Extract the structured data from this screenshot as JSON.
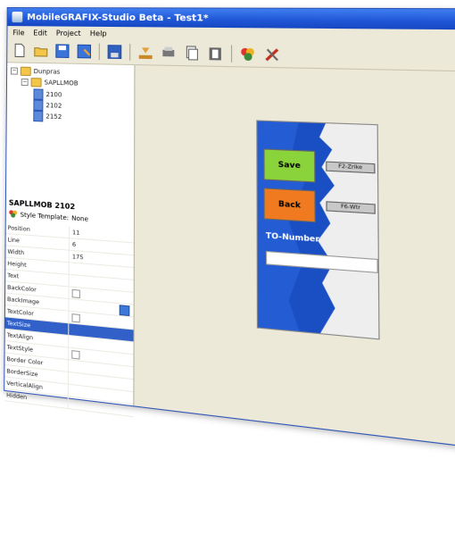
{
  "window": {
    "title": "MobileGRAFIX-Studio Beta - Test1*",
    "buttons": [
      "_",
      "□",
      "✕"
    ]
  },
  "menu": [
    "File",
    "Edit",
    "Project",
    "Help"
  ],
  "toolbar": {
    "icons": [
      "new-icon",
      "open-icon",
      "save-icon",
      "save-as-icon",
      "save-disk-icon",
      "import-icon",
      "export-icon",
      "copy-icon",
      "paste-icon",
      "palette-icon",
      "tools-icon"
    ]
  },
  "tree": {
    "root": "Dunpras",
    "project": "SAPLLMOB",
    "screens": [
      "2100",
      "2102",
      "2152"
    ]
  },
  "selection": {
    "title": "SAPLLMOB 2102",
    "style_label": "Style Template:",
    "style_value": "None"
  },
  "properties": [
    {
      "name": "Position",
      "value": "11"
    },
    {
      "name": "Line",
      "value": "6"
    },
    {
      "name": "Width",
      "value": "175"
    },
    {
      "name": "Height",
      "value": ""
    },
    {
      "name": "Text",
      "value": ""
    },
    {
      "name": "BackColor",
      "value": ""
    },
    {
      "name": "BackImage",
      "value": ""
    },
    {
      "name": "TextColor",
      "value": ""
    },
    {
      "name": "TextSize",
      "value": "",
      "selected": true
    },
    {
      "name": "TextAlign",
      "value": ""
    },
    {
      "name": "TextStyle",
      "value": ""
    },
    {
      "name": "Border Color",
      "value": ""
    },
    {
      "name": "BorderSize",
      "value": ""
    },
    {
      "name": "VerticalAlign",
      "value": ""
    },
    {
      "name": "Hidden",
      "value": ""
    }
  ],
  "device": {
    "save_label": "Save",
    "back_label": "Back",
    "key1_label": "F2-Zrike",
    "key2_label": "F6-Wtr",
    "to_number_label": "TO-Number"
  },
  "colors": {
    "titlebar": "#1f56d6",
    "save_green": "#8bd33a",
    "back_orange": "#f07a1f",
    "device_blue": "#1a4fc4",
    "selected_row": "#3160c8"
  }
}
